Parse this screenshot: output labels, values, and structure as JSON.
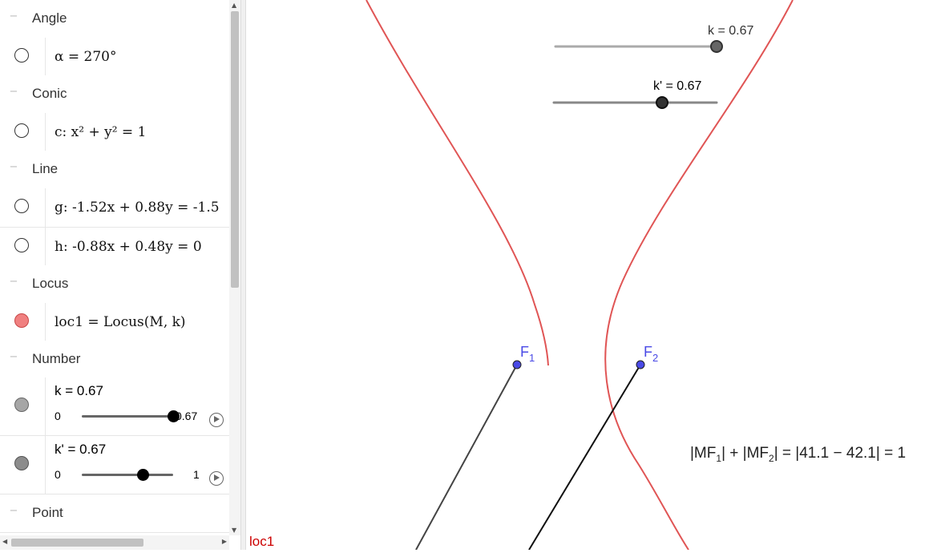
{
  "algebra": {
    "groups": {
      "angle": "Angle",
      "conic": "Conic",
      "line": "Line",
      "locus": "Locus",
      "number": "Number",
      "point": "Point"
    },
    "items": {
      "alpha": "α = 270°",
      "c": "c: x² + y² = 1",
      "g": "g: -1.52x + 0.88y = -1.5",
      "h": "h: -0.88x + 0.48y = 0",
      "loc1": "loc1 = Locus(M, k)",
      "k": {
        "title": "k = 0.67",
        "min": "0",
        "max": "0.67",
        "value": 0.67,
        "range": [
          0,
          0.67
        ]
      },
      "k2": {
        "title": "k' = 0.67",
        "min": "0",
        "max": "1",
        "value": 0.67,
        "range": [
          0,
          1
        ]
      }
    }
  },
  "graphics": {
    "slider_k_label": "k = 0.67",
    "slider_k2_label": "k' = 0.67",
    "point_f1": "F",
    "point_f1_sub": "1",
    "point_f2": "F",
    "point_f2_sub": "2",
    "locus_label": "loc1",
    "equation": {
      "a": "|MF",
      "a_sub": "1",
      "b": "| + |MF",
      "b_sub": "2",
      "c": "| = |41.1 − 42.1| = 1"
    }
  },
  "colors": {
    "locus": "#e05555",
    "point": "#4a4ae6",
    "segment": "#444444",
    "marble_loc": "#f08080",
    "marble_k": "#a6a6a6",
    "marble_k2": "#8c8c8c"
  },
  "icons": {
    "collapse": "minus-icon",
    "play": "play-icon"
  }
}
